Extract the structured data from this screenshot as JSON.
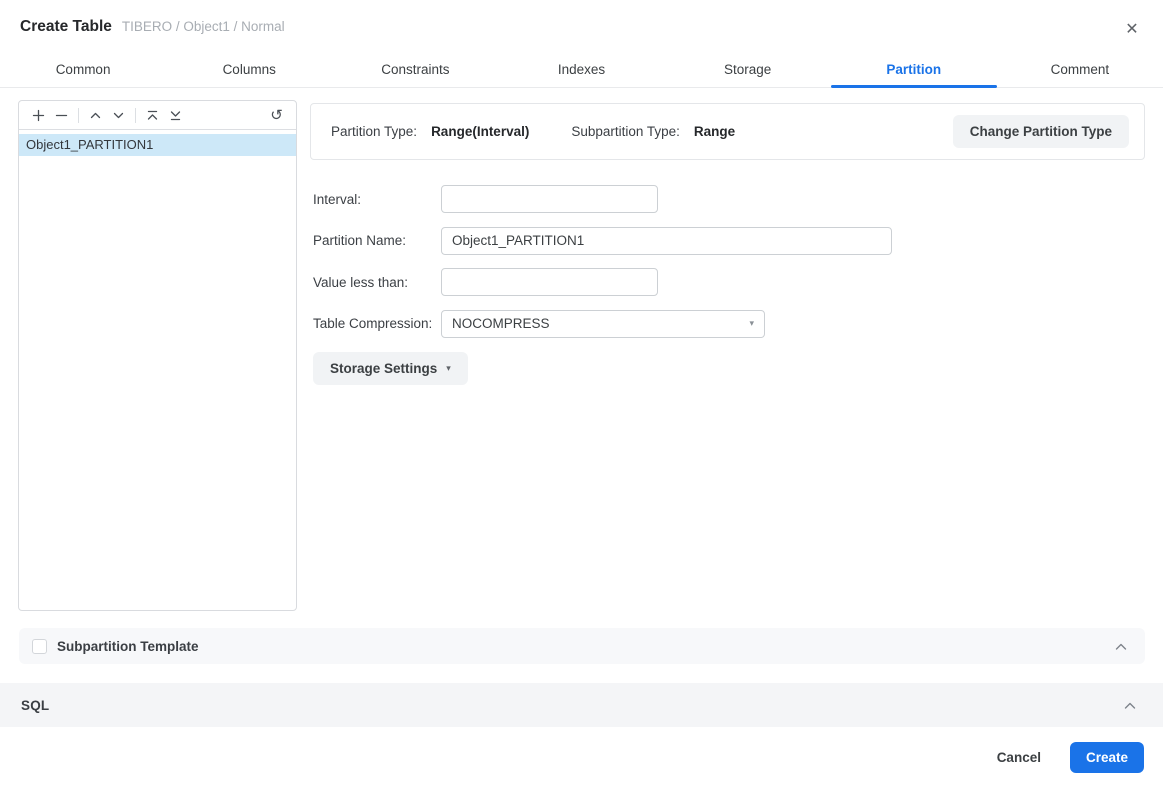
{
  "header": {
    "title": "Create Table",
    "subtitle": "TIBERO / Object1 / Normal"
  },
  "icons": {
    "close": "✕",
    "reset": "↺",
    "select_caret": "▾",
    "storage_caret": "▾"
  },
  "tabs": [
    {
      "label": "Common",
      "active": false
    },
    {
      "label": "Columns",
      "active": false
    },
    {
      "label": "Constraints",
      "active": false
    },
    {
      "label": "Indexes",
      "active": false
    },
    {
      "label": "Storage",
      "active": false
    },
    {
      "label": "Partition",
      "active": true
    },
    {
      "label": "Comment",
      "active": false
    }
  ],
  "partition_list": {
    "toolbar": [
      "add",
      "remove",
      "move-up",
      "move-down",
      "move-to-top",
      "move-to-bottom",
      "reset"
    ],
    "items": [
      {
        "label": "Object1_PARTITION1",
        "selected": true
      }
    ]
  },
  "type_bar": {
    "partition_type_label": "Partition Type:",
    "partition_type_value": "Range(Interval)",
    "subpartition_type_label": "Subpartition Type:",
    "subpartition_type_value": "Range",
    "change_button_label": "Change Partition Type"
  },
  "form": {
    "interval": {
      "label": "Interval:",
      "value": ""
    },
    "partition_name": {
      "label": "Partition Name:",
      "value": "Object1_PARTITION1"
    },
    "value_less_than": {
      "label": "Value less than:",
      "value": ""
    },
    "table_compression": {
      "label": "Table Compression:",
      "value": "NOCOMPRESS"
    },
    "storage_settings_label": "Storage Settings"
  },
  "sections": {
    "subpartition_template": {
      "label": "Subpartition Template",
      "checked": false,
      "collapsed": false
    },
    "sql": {
      "label": "SQL",
      "collapsed": false
    }
  },
  "footer": {
    "cancel_label": "Cancel",
    "create_label": "Create"
  },
  "colors": {
    "accent": "#1a73e8",
    "selected_item_bg": "#cde8f8",
    "button_gray_bg": "#f1f3f5"
  }
}
